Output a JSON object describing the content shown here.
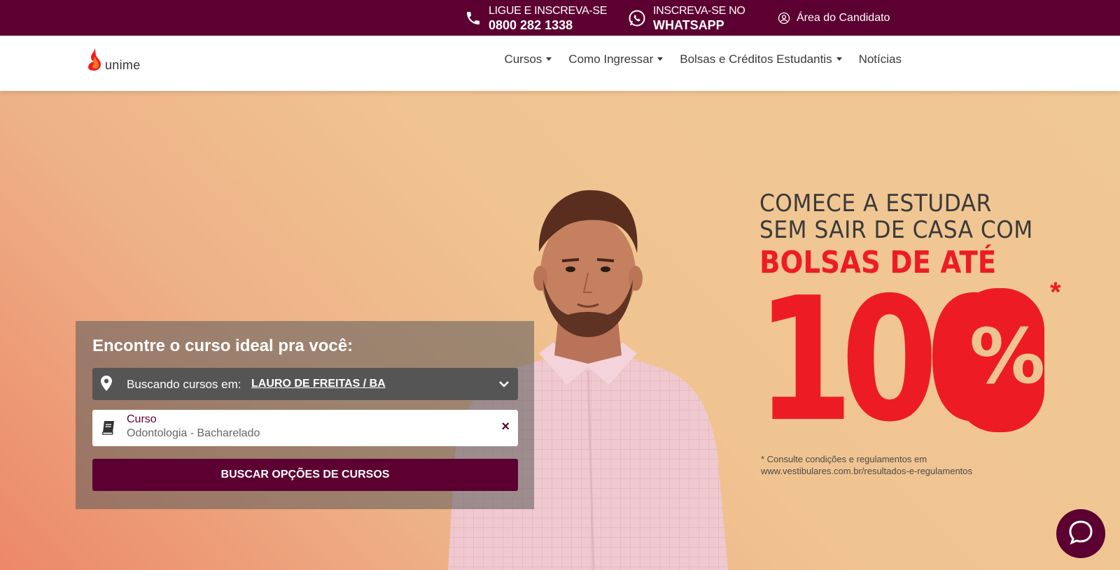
{
  "topbar": {
    "phone_line1": "LIGUE E INSCREVA-SE",
    "phone_line2": "0800 282 1338",
    "whatsapp_line1": "INSCREVA-SE NO",
    "whatsapp_line2": "WHATSAPP",
    "area_label": "Área do Candidato"
  },
  "nav": {
    "logo_text": "unime",
    "items": [
      {
        "label": "Cursos",
        "dropdown": true
      },
      {
        "label": "Como Ingressar",
        "dropdown": true
      },
      {
        "label": "Bolsas e Créditos Estudantis",
        "dropdown": true
      },
      {
        "label": "Notícias",
        "dropdown": false
      }
    ]
  },
  "hero": {
    "headline_line1": "COMECE A ESTUDAR",
    "headline_line2": "SEM SAIR DE CASA COM",
    "headline_red": "BOLSAS DE ATÉ",
    "big_number": "100",
    "big_percent": "%",
    "asterisk": "*",
    "disclaimer_line1": "* Consulte condições e regulamentos em",
    "disclaimer_line2": "www.vestibulares.com.br/resultados-e-regulamentos"
  },
  "search": {
    "title": "Encontre o curso ideal pra você:",
    "location_label": "Buscando cursos em:",
    "location_value": "LAURO DE FREITAS / BA",
    "course_label": "Curso",
    "course_value": "Odontologia - Bacharelado",
    "clear_symbol": "×",
    "button_label": "BUSCAR OPÇÕES DE CURSOS"
  },
  "colors": {
    "brand": "#5c0031",
    "accent_red": "#ed1c24",
    "hero_bg": "#f0c491"
  },
  "icons": {
    "phone": "phone-icon",
    "whatsapp": "whatsapp-icon",
    "user": "user-circle-icon",
    "logo": "flame-icon",
    "location": "map-pin-icon",
    "book": "book-icon",
    "chevron": "chevron-down-icon",
    "chat": "chat-bubble-icon"
  }
}
